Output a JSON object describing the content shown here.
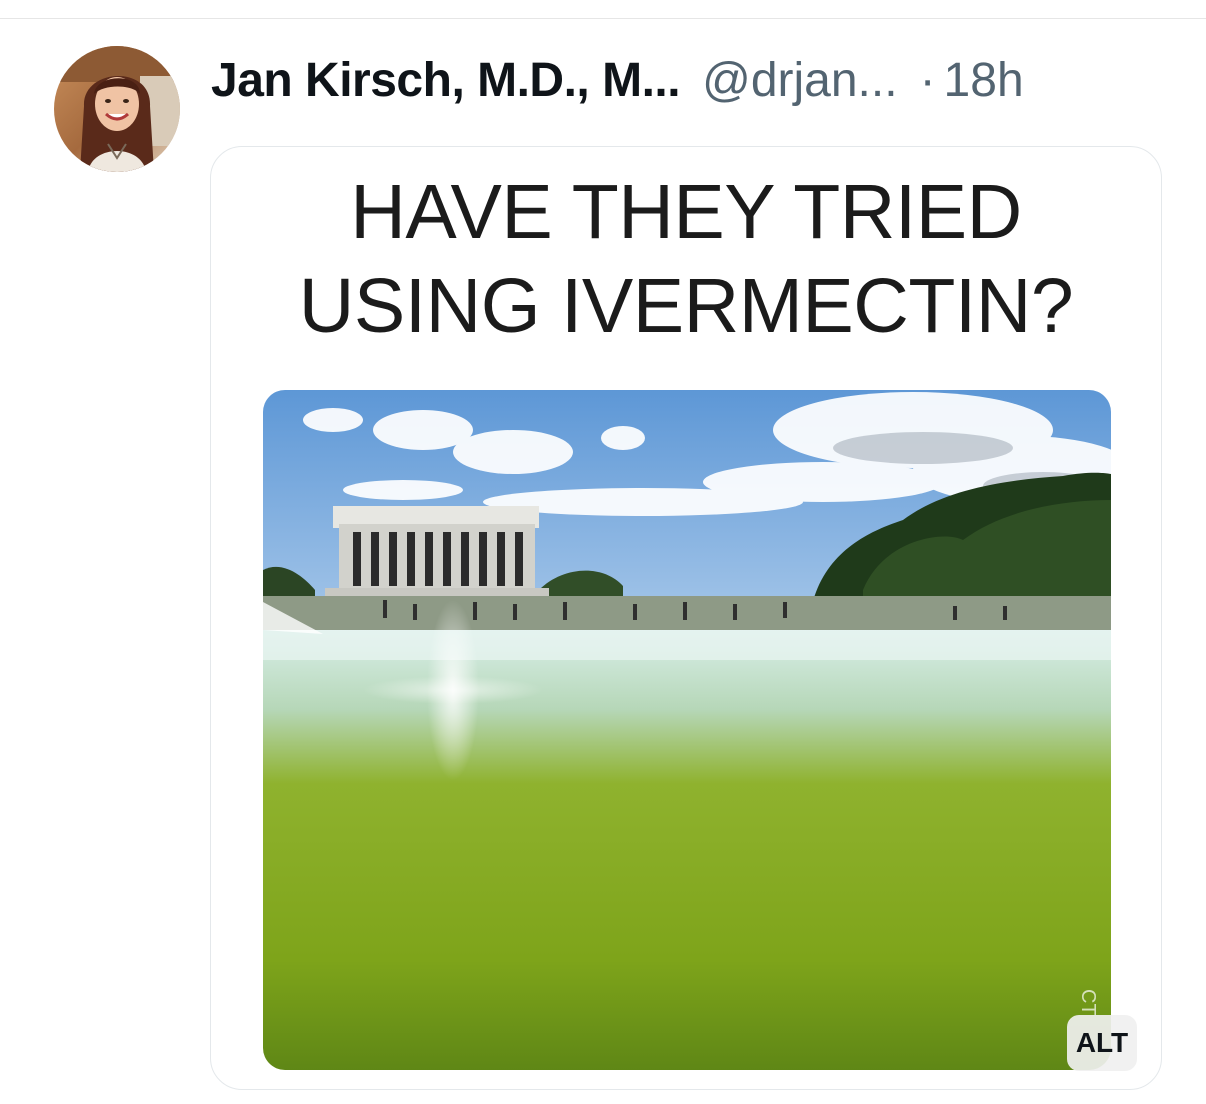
{
  "tweet": {
    "author_name": "Jan Kirsch, M.D., M...",
    "handle": "@drjan...",
    "separator": "·",
    "timestamp": "18h",
    "avatar_icon": "user-avatar-photo"
  },
  "media": {
    "caption_lines": [
      "HAVE THEY TRIED",
      "USING IVERMECTIN?"
    ],
    "image_subject": "reflecting-pool-photo",
    "watermark": "CT",
    "alt_badge": "ALT"
  },
  "colors": {
    "text_primary": "#0f1419",
    "text_secondary": "#536471",
    "card_border": "#e4e8eb",
    "water_green": "#7fa51c"
  }
}
